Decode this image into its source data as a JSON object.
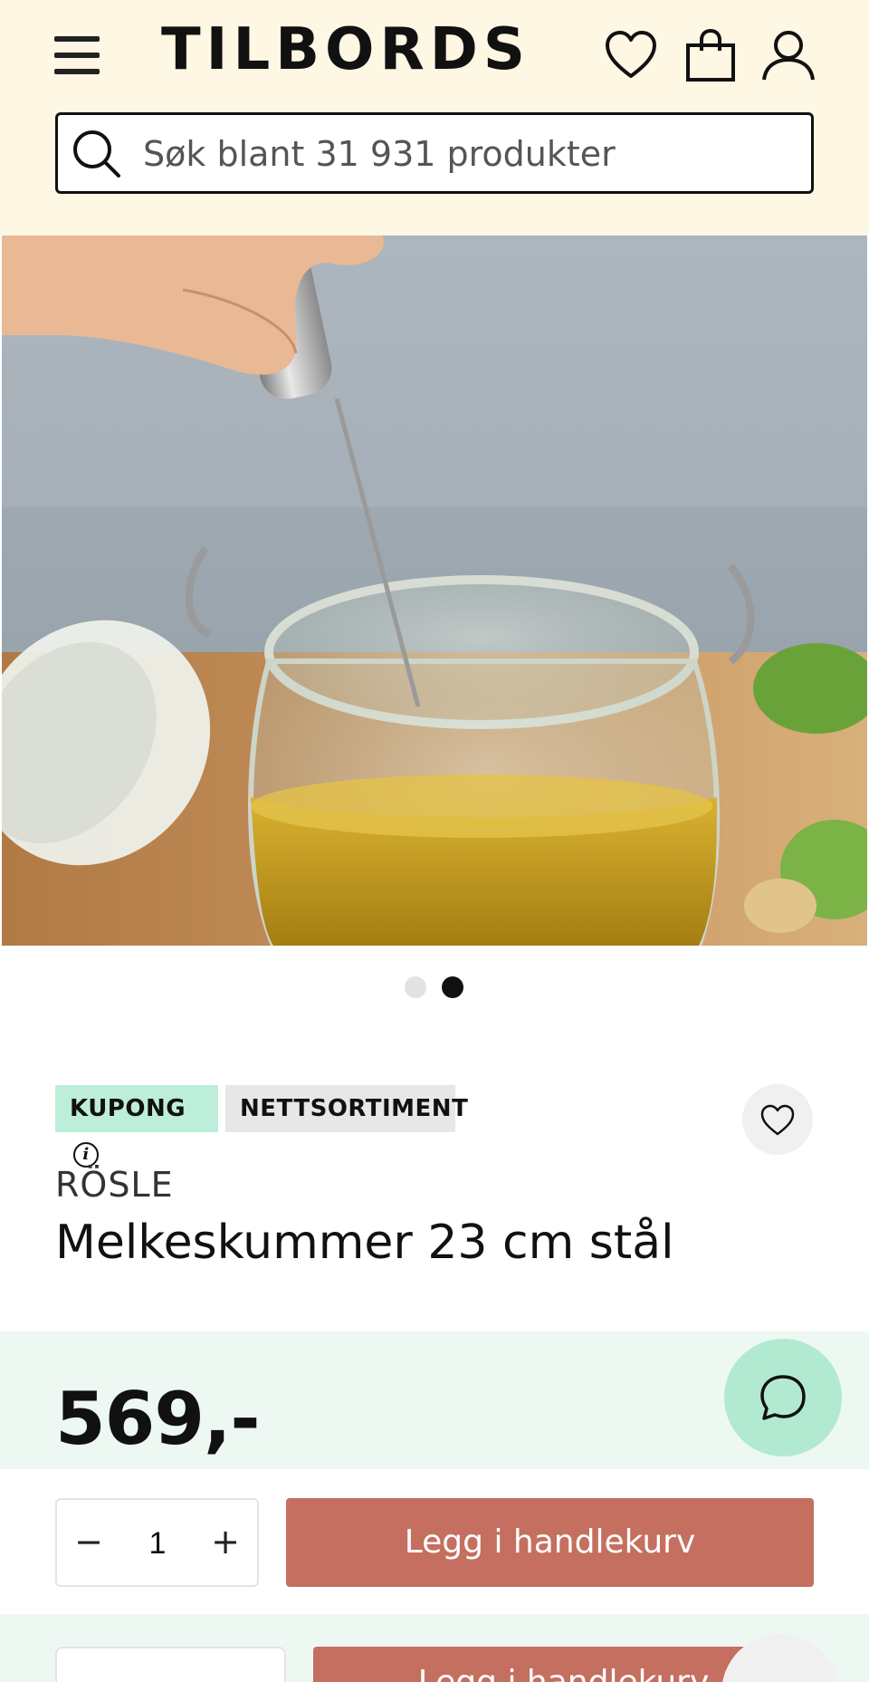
{
  "header": {
    "logo": "TILBORDS",
    "search_placeholder": "Søk blant 31 931 produkter",
    "icons": {
      "menu": "hamburger-menu-icon",
      "wishlist": "heart-icon",
      "cart": "shopping-bag-icon",
      "account": "user-icon",
      "search": "search-icon"
    }
  },
  "gallery": {
    "image_alt": "Melkeskummer i glass med dressing",
    "slides": 2,
    "active_slide": 2
  },
  "product": {
    "badges": {
      "coupon": "KUPONG",
      "coupon_info": "i",
      "net": "NETTSORTIMENT"
    },
    "brand": "RÖSLE",
    "title": "Melkeskummer 23 cm stål",
    "price": "569,-"
  },
  "purchase": {
    "quantity": "1",
    "minus": "−",
    "plus": "+",
    "add_to_cart": "Legg i handlekurv"
  },
  "colors": {
    "header_bg": "#fdf7e3",
    "coupon_badge": "#bdeed9",
    "net_badge": "#e8e6e6",
    "price_band": "#eef8f3",
    "chat_button": "#b2ead1",
    "cart_button": "#c46f5f"
  }
}
